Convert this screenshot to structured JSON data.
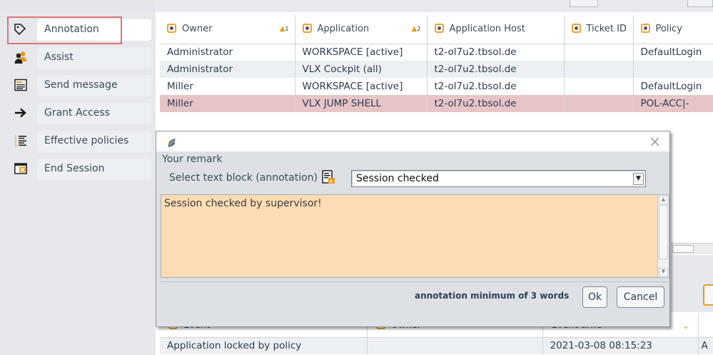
{
  "actions": [
    {
      "label": "Annotation",
      "icon": "tag-icon"
    },
    {
      "label": "Assist",
      "icon": "users-icon"
    },
    {
      "label": "Send message",
      "icon": "message-icon"
    },
    {
      "label": "Grant Access",
      "icon": "arrow-right-icon"
    },
    {
      "label": "Effective policies",
      "icon": "list-icon"
    },
    {
      "label": "End Session",
      "icon": "end-session-icon"
    }
  ],
  "sessions": {
    "columns": [
      {
        "label": "Owner",
        "sort": "1"
      },
      {
        "label": "Application",
        "sort": "2"
      },
      {
        "label": "Application Host",
        "sort": ""
      },
      {
        "label": "Ticket ID",
        "sort": ""
      },
      {
        "label": "Policy",
        "sort": ""
      }
    ],
    "rows": [
      {
        "owner": "Administrator",
        "application": "WORKSPACE [active]",
        "host": "t2-ol7u2.tbsol.de",
        "ticket": "",
        "policy": "DefaultLogin"
      },
      {
        "owner": "Administrator",
        "application": "VLX Cockpit (all)",
        "host": "t2-ol7u2.tbsol.de",
        "ticket": "",
        "policy": ""
      },
      {
        "owner": "Miller",
        "application": "WORKSPACE [active]",
        "host": "t2-ol7u2.tbsol.de",
        "ticket": "",
        "policy": "DefaultLogin"
      },
      {
        "owner": "Miller",
        "application": "VLX JUMP SHELL",
        "host": "t2-ol7u2.tbsol.de",
        "ticket": "",
        "policy": "POL-ACC|-"
      }
    ]
  },
  "dialog": {
    "remark_label": "Your remark",
    "select_label": "Select text block (annotation)",
    "select_value": "Session checked",
    "text": "Session checked by supervisor!",
    "hint": "annotation minimum of 3 words",
    "ok_label": "Ok",
    "cancel_label": "Cancel",
    "close_glyph": "×"
  },
  "events": {
    "columns": [
      "Event",
      "Owner",
      "Event time"
    ],
    "rows": [
      {
        "event": "Application locked by policy",
        "owner": "",
        "time": "2021-03-08 08:15:23",
        "extra": "A"
      }
    ]
  },
  "colors": {
    "accent_orange": "#e89b1a",
    "selected_row": "#e7c5c7",
    "highlight_border": "#e1737a",
    "remark_bg": "#fcdcb4"
  }
}
